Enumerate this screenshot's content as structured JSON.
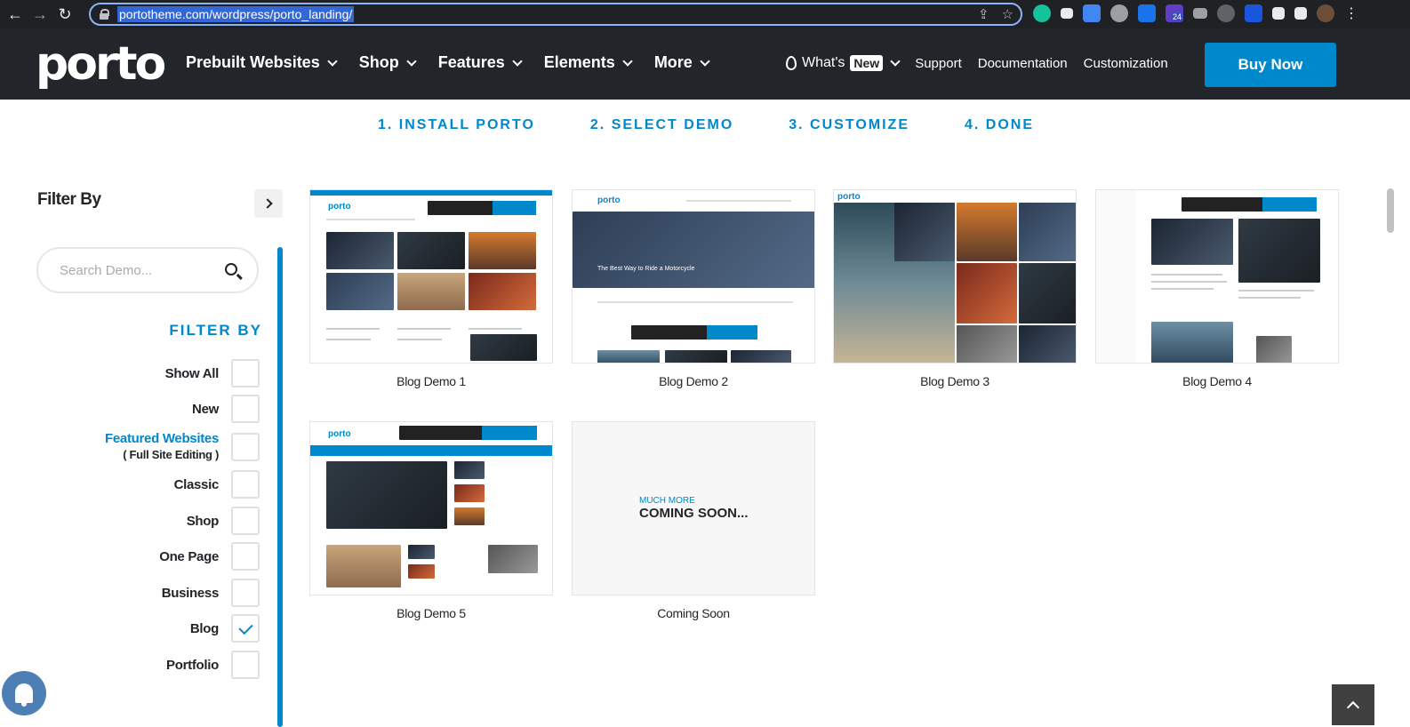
{
  "browser": {
    "url": "portotheme.com/wordpress/porto_landing/",
    "ext_badge": "24"
  },
  "header": {
    "logo": "porto",
    "nav": [
      "Prebuilt Websites",
      "Shop",
      "Features",
      "Elements",
      "More"
    ],
    "whats": "What's",
    "new_badge": "New",
    "support": "Support",
    "documentation": "Documentation",
    "customization": "Customization",
    "buy": "Buy Now"
  },
  "steps": [
    "1. INSTALL PORTO",
    "2. SELECT DEMO",
    "3. CUSTOMIZE",
    "4. DONE"
  ],
  "sidebar": {
    "title": "Filter By",
    "search_placeholder": "Search Demo...",
    "filter_by": "FILTER BY",
    "filters": [
      {
        "label": "Show All",
        "checked": false
      },
      {
        "label": "New",
        "checked": false
      },
      {
        "label": "Featured Websites",
        "sub": "( Full Site Editing )",
        "checked": false
      },
      {
        "label": "Classic",
        "checked": false
      },
      {
        "label": "Shop",
        "checked": false
      },
      {
        "label": "One Page",
        "checked": false
      },
      {
        "label": "Business",
        "checked": false
      },
      {
        "label": "Blog",
        "checked": true
      },
      {
        "label": "Portfolio",
        "checked": false
      }
    ]
  },
  "demos": [
    {
      "label": "Blog Demo 1"
    },
    {
      "label": "Blog Demo 2",
      "caption": "The Best Way to Ride a Motorcycle"
    },
    {
      "label": "Blog Demo 3"
    },
    {
      "label": "Blog Demo 4"
    },
    {
      "label": "Blog Demo 5"
    },
    {
      "label": "Coming Soon",
      "much": "MUCH MORE",
      "soon": "COMING SOON..."
    }
  ],
  "colors": {
    "accent": "#0088cc",
    "header_bg": "#222529"
  }
}
